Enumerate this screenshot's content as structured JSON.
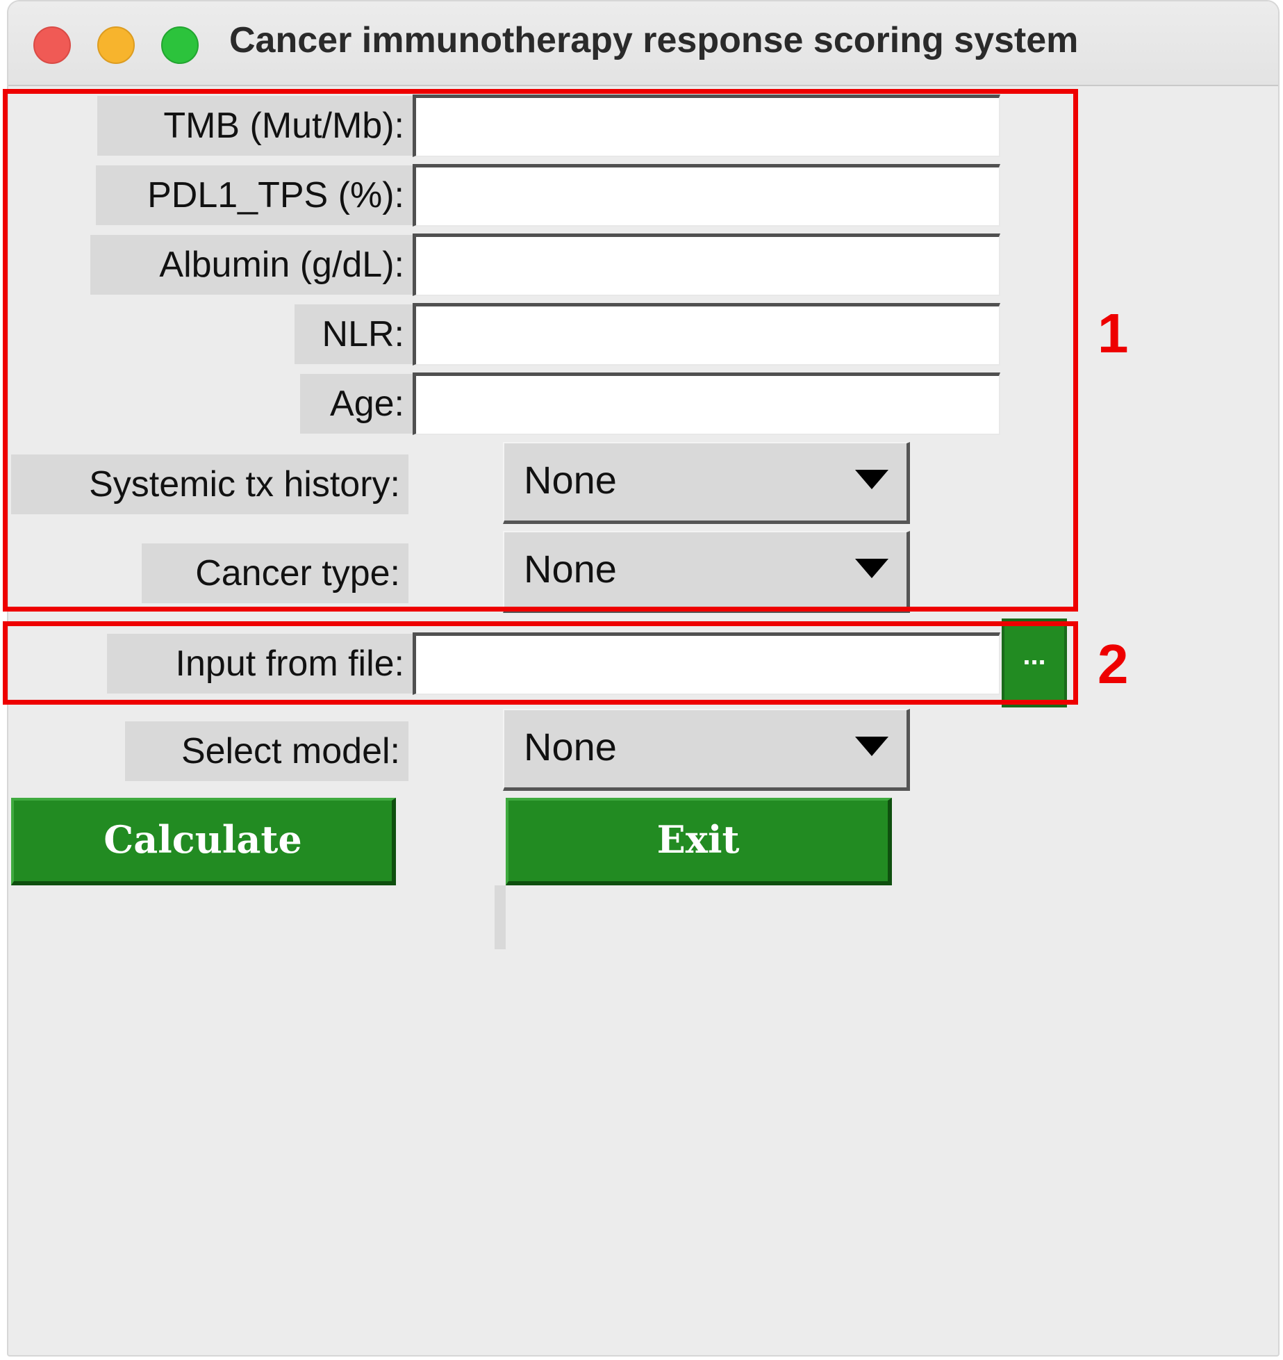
{
  "window": {
    "title": "Cancer immunotherapy response scoring system"
  },
  "form": {
    "tmb_label": "TMB (Mut/Mb):",
    "pdl1_label": "PDL1_TPS (%):",
    "albumin_label": "Albumin (g/dL):",
    "nlr_label": "NLR:",
    "age_label": "Age:",
    "tmb_value": "",
    "pdl1_value": "",
    "albumin_value": "",
    "nlr_value": "",
    "age_value": "",
    "systemic_label": "Systemic tx history:",
    "systemic_value": "None",
    "cancer_label": "Cancer type:",
    "cancer_value": "None",
    "file_label": "Input from file:",
    "file_value": "",
    "browse_label": "...",
    "model_label": "Select model:",
    "model_value": "None"
  },
  "buttons": {
    "calculate": "Calculate",
    "exit": "Exit"
  },
  "annotations": {
    "box1_number": "1",
    "box2_number": "2",
    "color": "#ee0000"
  },
  "colors": {
    "button_green": "#228b22",
    "window_bg": "#ececec",
    "label_bg": "#d9d9d9"
  },
  "icons": {
    "dropdown": "triangle-down-icon",
    "close": "close-window-icon",
    "minimize": "minimize-window-icon",
    "zoom": "zoom-window-icon"
  }
}
